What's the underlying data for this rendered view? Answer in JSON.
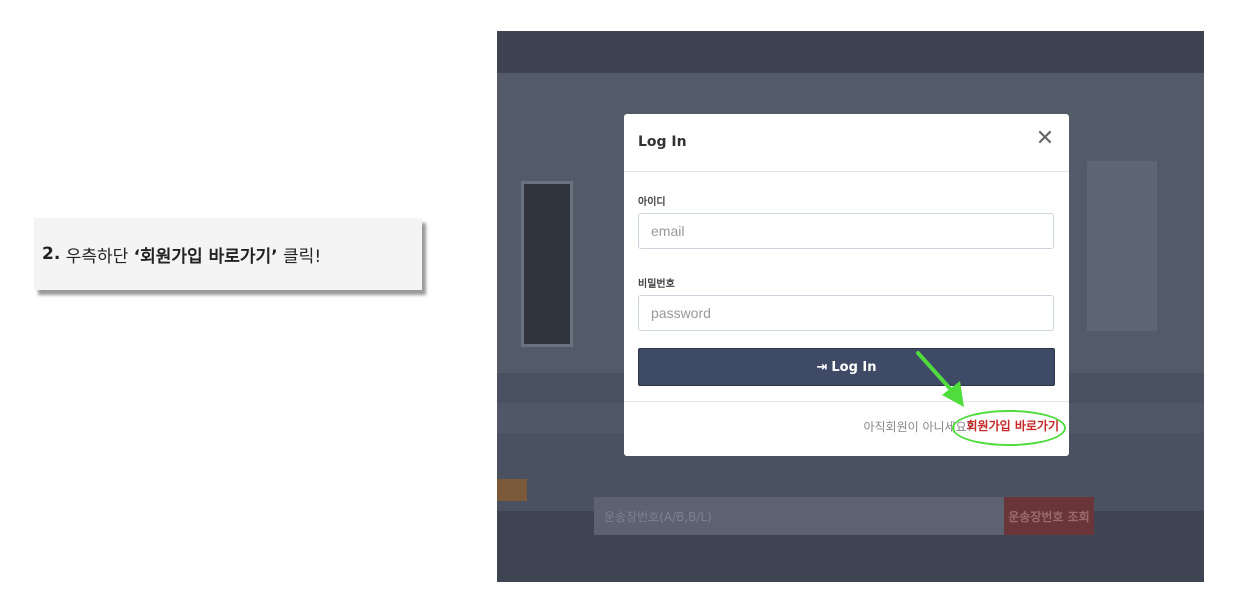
{
  "instruction": {
    "step_number": "2.",
    "prefix": "우측하단",
    "quoted": "‘회원가입 바로가기’",
    "suffix": "클릭!"
  },
  "background": {
    "search_placeholder": "운송장번호(A/B,B/L)",
    "search_button": "운송장번호 조회"
  },
  "modal": {
    "title": "Log In",
    "close_symbol": "✕",
    "id_label": "아이디",
    "id_placeholder": "email",
    "pw_label": "비밀번호",
    "pw_placeholder": "password",
    "login_button": "Log In",
    "login_icon_glyph": "⇥",
    "footer_text": "아직회원이 아니세요?",
    "signup_link": "회원가입 바로가기"
  },
  "colors": {
    "login_button_bg": "#3f4a66",
    "signup_link": "#c62828",
    "highlight": "#4fdc3c"
  }
}
